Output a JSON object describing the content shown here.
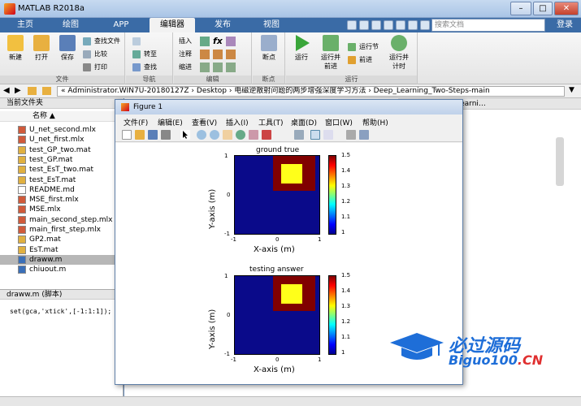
{
  "app": {
    "title": "MATLAB R2018a",
    "search_placeholder": "搜索文档",
    "login": "登录",
    "window_buttons": [
      "–",
      "□",
      "✕"
    ]
  },
  "tabs": [
    {
      "label": "主页"
    },
    {
      "label": "绘图"
    },
    {
      "label": "APP"
    },
    {
      "label": "编辑器",
      "active": true
    },
    {
      "label": "发布"
    },
    {
      "label": "视图"
    }
  ],
  "ribbon": {
    "file_group": {
      "label": "文件",
      "new": "新建",
      "open": "打开",
      "save": "保存",
      "find_files": "查找文件",
      "compare": "比较",
      "print": "打印"
    },
    "nav_group": {
      "label": "导航",
      "goto": "转至",
      "find": "查找"
    },
    "edit_group": {
      "label": "编辑",
      "insert": "插入",
      "comment": "注释",
      "indent": "缩进"
    },
    "breakpoint_group": {
      "label": "断点",
      "breakpoints": "断点"
    },
    "run_group": {
      "label": "运行",
      "run": "运行",
      "run_advance": "运行并\n前进",
      "run_section": "运行节",
      "advance": "前进",
      "run_time": "运行并\n计时"
    }
  },
  "address": {
    "path": "« Administrator.WIN7U-20180127Z › Desktop › 电磁逆散射问题的两步增强深度学习方法 › Deep_Learning_Two-Steps-main"
  },
  "folder": {
    "header": "当前文件夹",
    "column": "名称 ▲",
    "files": [
      {
        "name": "U_net_second.mlx",
        "type": "mlx"
      },
      {
        "name": "U_net_first.mlx",
        "type": "mlx"
      },
      {
        "name": "test_GP_two.mat",
        "type": "mat"
      },
      {
        "name": "test_GP.mat",
        "type": "mat"
      },
      {
        "name": "test_EsT_two.mat",
        "type": "mat"
      },
      {
        "name": "test_EsT.mat",
        "type": "mat"
      },
      {
        "name": "README.md",
        "type": "md"
      },
      {
        "name": "MSE_first.mlx",
        "type": "mlx"
      },
      {
        "name": "MSE.mlx",
        "type": "mlx"
      },
      {
        "name": "main_second_step.mlx",
        "type": "mlx"
      },
      {
        "name": "main_first_step.mlx",
        "type": "mlx"
      },
      {
        "name": "GP2.mat",
        "type": "mat"
      },
      {
        "name": "EsT.mat",
        "type": "mat"
      },
      {
        "name": "draww.m",
        "type": "m",
        "selected": true
      },
      {
        "name": "chiuout.m",
        "type": "m"
      }
    ]
  },
  "details": {
    "header": "draww.m  (脚本)",
    "code": "set(gca,'xtick',[-1:1:1]);"
  },
  "editor_tab": "学习方法\\Deep_Learni…",
  "figure": {
    "title": "Figure 1",
    "menus": [
      "文件(F)",
      "编辑(E)",
      "查看(V)",
      "插入(I)",
      "工具(T)",
      "桌面(D)",
      "窗口(W)",
      "帮助(H)"
    ],
    "plots": [
      {
        "title": "ground true"
      },
      {
        "title": "testing answer"
      }
    ],
    "xlabel": "X-axis (m)",
    "ylabel": "Y-axis (m)"
  },
  "chart_data": [
    {
      "type": "heatmap",
      "title": "ground true",
      "xlabel": "X-axis (m)",
      "ylabel": "Y-axis (m)",
      "xlim": [
        -1,
        1
      ],
      "ylim": [
        -1,
        1
      ],
      "xticks": [
        "-1",
        "0",
        "1"
      ],
      "yticks": [
        "1",
        "0",
        "-1"
      ],
      "colorbar_ticks": [
        "1.5",
        "1.4",
        "1.3",
        "1.2",
        "1.1",
        "1"
      ],
      "regions": [
        {
          "label": "background",
          "value": 1.0,
          "color": "#0a0a8a"
        },
        {
          "label": "outer square",
          "value": 1.5,
          "color": "#800000",
          "x": [
            -0.1,
            0.9
          ],
          "y": [
            0.1,
            1.0
          ]
        },
        {
          "label": "inner square",
          "value": 1.3,
          "color": "#ffff1a",
          "x": [
            0.1,
            0.6
          ],
          "y": [
            0.3,
            0.8
          ]
        }
      ]
    },
    {
      "type": "heatmap",
      "title": "testing answer",
      "xlabel": "X-axis (m)",
      "ylabel": "Y-axis (m)",
      "xlim": [
        -1,
        1
      ],
      "ylim": [
        -1,
        1
      ],
      "xticks": [
        "-1",
        "0",
        "1"
      ],
      "yticks": [
        "1",
        "0",
        "-1"
      ],
      "colorbar_ticks": [
        "1.5",
        "1.4",
        "1.3",
        "1.2",
        "1.1",
        "1"
      ],
      "regions": [
        {
          "label": "background",
          "value": 1.0,
          "color": "#0a0a8a"
        },
        {
          "label": "outer square",
          "value": 1.5,
          "color": "#800000",
          "x": [
            -0.1,
            0.9
          ],
          "y": [
            0.1,
            1.0
          ]
        },
        {
          "label": "inner square",
          "value": 1.3,
          "color": "#ffff1a",
          "x": [
            0.1,
            0.6
          ],
          "y": [
            0.3,
            0.8
          ]
        }
      ]
    }
  ],
  "watermark": {
    "name": "必过源码",
    "url_main": "Biguo100",
    "url_tld": ".CN"
  }
}
